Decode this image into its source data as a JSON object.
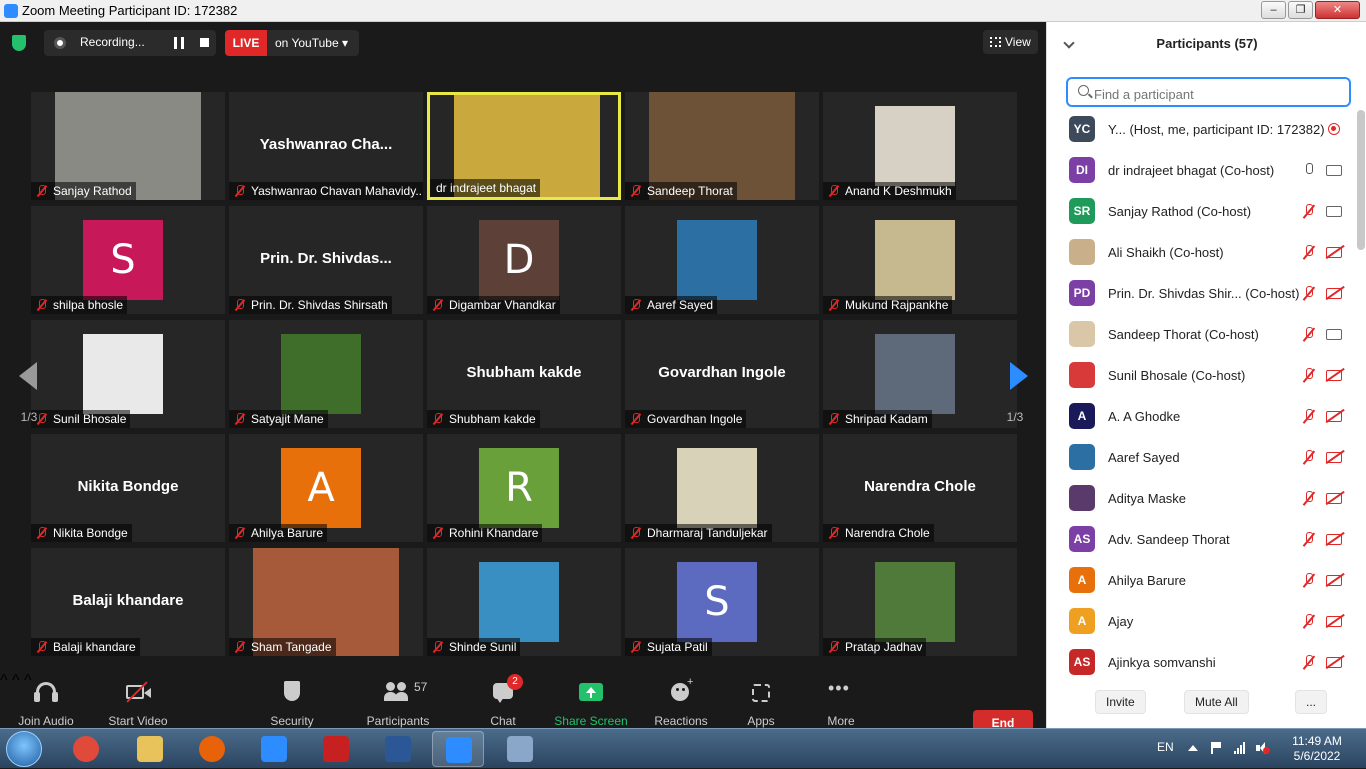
{
  "window": {
    "title": "Zoom Meeting Participant ID: 172382",
    "controls": [
      "–",
      "❐",
      "✕"
    ]
  },
  "topbar": {
    "recording_label": "Recording...",
    "live_label": "LIVE",
    "live_target": "on YouTube ▾",
    "view_label": "View"
  },
  "gallery": {
    "page_label_left": "1/3",
    "page_label_right": "1/3",
    "tiles": [
      {
        "name": "Sanjay Rathod",
        "type": "photo",
        "color": "#8a8a85"
      },
      {
        "name": "Yashwanrao Chavan Mahavidy...",
        "big": "Yashwanrao  Cha...",
        "type": "text"
      },
      {
        "name": "dr indrajeet bhagat",
        "type": "photo",
        "color": "#c9a83e",
        "active": true
      },
      {
        "name": "Sandeep Thorat",
        "type": "photo",
        "color": "#6e5238"
      },
      {
        "name": "Anand K Deshmukh",
        "type": "photo",
        "color": "#d7d0c4"
      },
      {
        "name": "shilpa bhosle",
        "type": "avatar",
        "letter": "S",
        "color": "#c7185a"
      },
      {
        "name": "Prin. Dr. Shivdas Shirsath",
        "big": "Prin.  Dr.  Shivdas...",
        "type": "text"
      },
      {
        "name": "Digambar Vhandkar",
        "type": "avatar",
        "letter": "D",
        "color": "#5d4037"
      },
      {
        "name": "Aaref Sayed",
        "type": "photo",
        "color": "#2c6fa3"
      },
      {
        "name": "Mukund Rajpankhe",
        "type": "photo",
        "color": "#c7b98f"
      },
      {
        "name": "Sunil Bhosale",
        "type": "photo",
        "color": "#e9e9e9"
      },
      {
        "name": "Satyajit Mane",
        "type": "photo",
        "color": "#3f6e2a"
      },
      {
        "name": "Shubham kakde",
        "big": "Shubham kakde",
        "type": "text"
      },
      {
        "name": "Govardhan Ingole",
        "big": "Govardhan Ingole",
        "type": "text"
      },
      {
        "name": "Shripad Kadam",
        "type": "photo",
        "color": "#5e6a7a"
      },
      {
        "name": "Nikita Bondge",
        "big": "Nikita Bondge",
        "type": "text"
      },
      {
        "name": "Ahilya Barure",
        "type": "avatar",
        "letter": "A",
        "color": "#e8700a"
      },
      {
        "name": "Rohini Khandare",
        "type": "avatar",
        "letter": "R",
        "color": "#6aa03a"
      },
      {
        "name": "Dharmaraj Tanduljekar",
        "type": "photo",
        "color": "#d8d2b8"
      },
      {
        "name": "Narendra Chole",
        "big": "Narendra Chole",
        "type": "text"
      },
      {
        "name": "Balaji khandare",
        "big": "Balaji khandare",
        "type": "text"
      },
      {
        "name": "Sham Tangade",
        "type": "photo",
        "color": "#a65a3a"
      },
      {
        "name": "Shinde Sunil",
        "type": "photo",
        "color": "#3a8fc2"
      },
      {
        "name": "Sujata Patil",
        "type": "avatar",
        "letter": "S",
        "color": "#5c6bc0"
      },
      {
        "name": "Pratap Jadhav",
        "type": "photo",
        "color": "#4f7a3a"
      }
    ]
  },
  "toolbar": {
    "join_audio": "Join Audio",
    "start_video": "Start Video",
    "security": "Security",
    "participants": "Participants",
    "participants_count": "57",
    "chat": "Chat",
    "chat_badge": "2",
    "share_screen": "Share Screen",
    "reactions": "Reactions",
    "apps": "Apps",
    "more": "More",
    "end": "End"
  },
  "panel": {
    "title": "Participants (57)",
    "search_placeholder": "Find a participant",
    "participants": [
      {
        "initials": "YC",
        "color": "#3d4a5c",
        "name": "Y... (Host, me, participant ID: 172382)",
        "status": "rec"
      },
      {
        "initials": "DI",
        "color": "#7b3fa6",
        "name": "dr indrajeet bhagat (Co-host)",
        "mic": "on",
        "cam": "on"
      },
      {
        "initials": "SR",
        "color": "#1e9a5a",
        "name": "Sanjay Rathod (Co-host)",
        "mic": "off",
        "cam": "on"
      },
      {
        "initials": "",
        "color": "#c9b08a",
        "name": "Ali Shaikh (Co-host)",
        "mic": "off",
        "cam": "off"
      },
      {
        "initials": "PD",
        "color": "#7b3fa6",
        "name": "Prin. Dr. Shivdas Shir...  (Co-host)",
        "mic": "off",
        "cam": "off"
      },
      {
        "initials": "",
        "color": "#d9c7a8",
        "name": "Sandeep Thorat (Co-host)",
        "mic": "off",
        "cam": "on"
      },
      {
        "initials": "",
        "color": "#d83a3a",
        "name": "Sunil Bhosale (Co-host)",
        "mic": "off",
        "cam": "off"
      },
      {
        "initials": "A",
        "color": "#1a1a5a",
        "name": "A. A Ghodke",
        "mic": "off",
        "cam": "off"
      },
      {
        "initials": "",
        "color": "#2c6fa3",
        "name": "Aaref Sayed",
        "mic": "off",
        "cam": "off"
      },
      {
        "initials": "",
        "color": "#5a3a6a",
        "name": "Aditya Maske",
        "mic": "off",
        "cam": "off"
      },
      {
        "initials": "AS",
        "color": "#7b3fa6",
        "name": "Adv. Sandeep Thorat",
        "mic": "off",
        "cam": "off"
      },
      {
        "initials": "A",
        "color": "#e8700a",
        "name": "Ahilya Barure",
        "mic": "off",
        "cam": "off"
      },
      {
        "initials": "A",
        "color": "#f0a020",
        "name": "Ajay",
        "mic": "off",
        "cam": "off"
      },
      {
        "initials": "AS",
        "color": "#c62828",
        "name": "Ajinkya somvanshi",
        "mic": "off",
        "cam": "off"
      }
    ],
    "invite": "Invite",
    "mute_all": "Mute All",
    "more": "..."
  },
  "taskbar": {
    "apps": [
      {
        "name": "chrome-icon",
        "color": "#e04a3a"
      },
      {
        "name": "file-explorer-icon",
        "color": "#e8c25a"
      },
      {
        "name": "firefox-icon",
        "color": "#e8620a"
      },
      {
        "name": "internet-explorer-icon",
        "color": "#2d8cff"
      },
      {
        "name": "acrobat-icon",
        "color": "#c62020"
      },
      {
        "name": "word-icon",
        "color": "#2b5797"
      },
      {
        "name": "zoom-icon",
        "color": "#2d8cff",
        "running": true
      },
      {
        "name": "paint-icon",
        "color": "#8aa7c9"
      }
    ],
    "language": "EN",
    "time": "11:49 AM",
    "date": "5/6/2022"
  }
}
